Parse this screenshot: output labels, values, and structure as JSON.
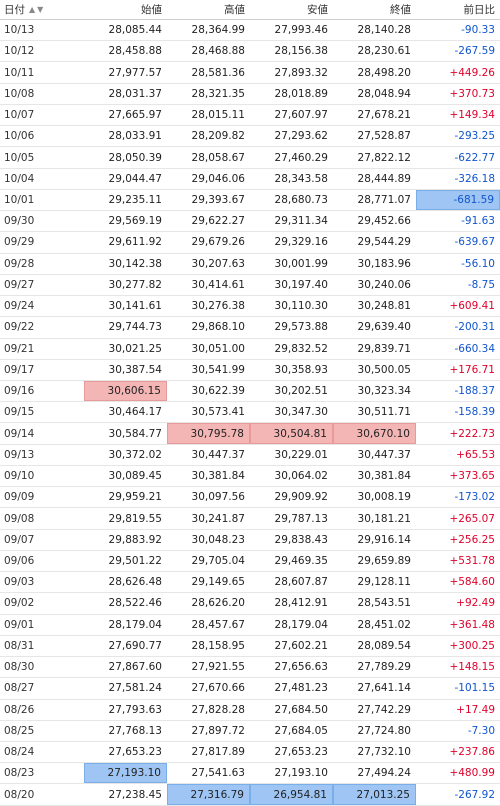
{
  "header": {
    "date": "日付",
    "open": "始値",
    "high": "高値",
    "low": "安値",
    "close": "終値",
    "change": "前日比",
    "sort_icons": "▲▼"
  },
  "rows": [
    {
      "date": "10/13",
      "open": "28,085.44",
      "high": "28,364.99",
      "low": "27,993.46",
      "close": "28,140.28",
      "change": "-90.33",
      "dir": "down"
    },
    {
      "date": "10/12",
      "open": "28,458.88",
      "high": "28,468.88",
      "low": "28,156.38",
      "close": "28,230.61",
      "change": "-267.59",
      "dir": "down"
    },
    {
      "date": "10/11",
      "open": "27,977.57",
      "high": "28,581.36",
      "low": "27,893.32",
      "close": "28,498.20",
      "change": "+449.26",
      "dir": "up"
    },
    {
      "date": "10/08",
      "open": "28,031.37",
      "high": "28,321.35",
      "low": "28,018.89",
      "close": "28,048.94",
      "change": "+370.73",
      "dir": "up"
    },
    {
      "date": "10/07",
      "open": "27,665.97",
      "high": "28,015.11",
      "low": "27,607.97",
      "close": "27,678.21",
      "change": "+149.34",
      "dir": "up"
    },
    {
      "date": "10/06",
      "open": "28,033.91",
      "high": "28,209.82",
      "low": "27,293.62",
      "close": "27,528.87",
      "change": "-293.25",
      "dir": "down"
    },
    {
      "date": "10/05",
      "open": "28,050.39",
      "high": "28,058.67",
      "low": "27,460.29",
      "close": "27,822.12",
      "change": "-622.77",
      "dir": "down"
    },
    {
      "date": "10/04",
      "open": "29,044.47",
      "high": "29,046.06",
      "low": "28,343.58",
      "close": "28,444.89",
      "change": "-326.18",
      "dir": "down"
    },
    {
      "date": "10/01",
      "open": "29,235.11",
      "high": "29,393.67",
      "low": "28,680.73",
      "close": "28,771.07",
      "change": "-681.59",
      "dir": "down",
      "hl": {
        "change": "blue"
      }
    },
    {
      "date": "09/30",
      "open": "29,569.19",
      "high": "29,622.27",
      "low": "29,311.34",
      "close": "29,452.66",
      "change": "-91.63",
      "dir": "down"
    },
    {
      "date": "09/29",
      "open": "29,611.92",
      "high": "29,679.26",
      "low": "29,329.16",
      "close": "29,544.29",
      "change": "-639.67",
      "dir": "down"
    },
    {
      "date": "09/28",
      "open": "30,142.38",
      "high": "30,207.63",
      "low": "30,001.99",
      "close": "30,183.96",
      "change": "-56.10",
      "dir": "down"
    },
    {
      "date": "09/27",
      "open": "30,277.82",
      "high": "30,414.61",
      "low": "30,197.40",
      "close": "30,240.06",
      "change": "-8.75",
      "dir": "down"
    },
    {
      "date": "09/24",
      "open": "30,141.61",
      "high": "30,276.38",
      "low": "30,110.30",
      "close": "30,248.81",
      "change": "+609.41",
      "dir": "up"
    },
    {
      "date": "09/22",
      "open": "29,744.73",
      "high": "29,868.10",
      "low": "29,573.88",
      "close": "29,639.40",
      "change": "-200.31",
      "dir": "down"
    },
    {
      "date": "09/21",
      "open": "30,021.25",
      "high": "30,051.00",
      "low": "29,832.52",
      "close": "29,839.71",
      "change": "-660.34",
      "dir": "down"
    },
    {
      "date": "09/17",
      "open": "30,387.54",
      "high": "30,541.99",
      "low": "30,358.93",
      "close": "30,500.05",
      "change": "+176.71",
      "dir": "up"
    },
    {
      "date": "09/16",
      "open": "30,606.15",
      "high": "30,622.39",
      "low": "30,202.51",
      "close": "30,323.34",
      "change": "-188.37",
      "dir": "down",
      "hl": {
        "open": "red"
      }
    },
    {
      "date": "09/15",
      "open": "30,464.17",
      "high": "30,573.41",
      "low": "30,347.30",
      "close": "30,511.71",
      "change": "-158.39",
      "dir": "down"
    },
    {
      "date": "09/14",
      "open": "30,584.77",
      "high": "30,795.78",
      "low": "30,504.81",
      "close": "30,670.10",
      "change": "+222.73",
      "dir": "up",
      "hl": {
        "high": "red",
        "low": "red",
        "close": "red"
      }
    },
    {
      "date": "09/13",
      "open": "30,372.02",
      "high": "30,447.37",
      "low": "30,229.01",
      "close": "30,447.37",
      "change": "+65.53",
      "dir": "up"
    },
    {
      "date": "09/10",
      "open": "30,089.45",
      "high": "30,381.84",
      "low": "30,064.02",
      "close": "30,381.84",
      "change": "+373.65",
      "dir": "up"
    },
    {
      "date": "09/09",
      "open": "29,959.21",
      "high": "30,097.56",
      "low": "29,909.92",
      "close": "30,008.19",
      "change": "-173.02",
      "dir": "down"
    },
    {
      "date": "09/08",
      "open": "29,819.55",
      "high": "30,241.87",
      "low": "29,787.13",
      "close": "30,181.21",
      "change": "+265.07",
      "dir": "up"
    },
    {
      "date": "09/07",
      "open": "29,883.92",
      "high": "30,048.23",
      "low": "29,838.43",
      "close": "29,916.14",
      "change": "+256.25",
      "dir": "up"
    },
    {
      "date": "09/06",
      "open": "29,501.22",
      "high": "29,705.04",
      "low": "29,469.35",
      "close": "29,659.89",
      "change": "+531.78",
      "dir": "up"
    },
    {
      "date": "09/03",
      "open": "28,626.48",
      "high": "29,149.65",
      "low": "28,607.87",
      "close": "29,128.11",
      "change": "+584.60",
      "dir": "up"
    },
    {
      "date": "09/02",
      "open": "28,522.46",
      "high": "28,626.20",
      "low": "28,412.91",
      "close": "28,543.51",
      "change": "+92.49",
      "dir": "up"
    },
    {
      "date": "09/01",
      "open": "28,179.04",
      "high": "28,457.67",
      "low": "28,179.04",
      "close": "28,451.02",
      "change": "+361.48",
      "dir": "up"
    },
    {
      "date": "08/31",
      "open": "27,690.77",
      "high": "28,158.95",
      "low": "27,602.21",
      "close": "28,089.54",
      "change": "+300.25",
      "dir": "up"
    },
    {
      "date": "08/30",
      "open": "27,867.60",
      "high": "27,921.55",
      "low": "27,656.63",
      "close": "27,789.29",
      "change": "+148.15",
      "dir": "up"
    },
    {
      "date": "08/27",
      "open": "27,581.24",
      "high": "27,670.66",
      "low": "27,481.23",
      "close": "27,641.14",
      "change": "-101.15",
      "dir": "down"
    },
    {
      "date": "08/26",
      "open": "27,793.63",
      "high": "27,828.28",
      "low": "27,684.50",
      "close": "27,742.29",
      "change": "+17.49",
      "dir": "up"
    },
    {
      "date": "08/25",
      "open": "27,768.13",
      "high": "27,897.72",
      "low": "27,684.05",
      "close": "27,724.80",
      "change": "-7.30",
      "dir": "down"
    },
    {
      "date": "08/24",
      "open": "27,653.23",
      "high": "27,817.89",
      "low": "27,653.23",
      "close": "27,732.10",
      "change": "+237.86",
      "dir": "up"
    },
    {
      "date": "08/23",
      "open": "27,193.10",
      "high": "27,541.63",
      "low": "27,193.10",
      "close": "27,494.24",
      "change": "+480.99",
      "dir": "up",
      "hl": {
        "open": "blue"
      }
    },
    {
      "date": "08/20",
      "open": "27,238.45",
      "high": "27,316.79",
      "low": "26,954.81",
      "close": "27,013.25",
      "change": "-267.92",
      "dir": "down",
      "hl": {
        "high": "blue",
        "low": "blue",
        "close": "blue"
      }
    }
  ]
}
